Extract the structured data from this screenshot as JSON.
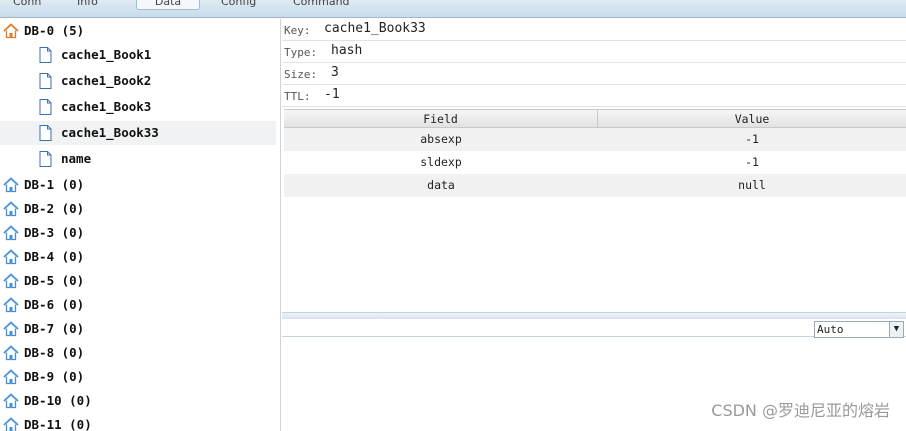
{
  "tabs": [
    "Conn",
    "Info",
    "Data",
    "Config",
    "Command"
  ],
  "tree": {
    "db0": {
      "label": "DB-0 (5)"
    },
    "keys": [
      "cache1_Book1",
      "cache1_Book2",
      "cache1_Book3",
      "cache1_Book33",
      "name"
    ],
    "dbs": [
      "DB-1 (0)",
      "DB-2 (0)",
      "DB-3 (0)",
      "DB-4 (0)",
      "DB-5 (0)",
      "DB-6 (0)",
      "DB-7 (0)",
      "DB-8 (0)",
      "DB-9 (0)",
      "DB-10 (0)",
      "DB-11 (0)"
    ]
  },
  "detail": {
    "key_label": "Key:",
    "key_value": "cache1_Book33",
    "type_label": "Type:",
    "type_value": "hash",
    "size_label": "Size:",
    "size_value": "3",
    "ttl_label": "TTL:",
    "ttl_value": "-1"
  },
  "grid": {
    "headers": {
      "field": "Field",
      "value": "Value"
    },
    "rows": [
      {
        "field": "absexp",
        "value": "-1"
      },
      {
        "field": "sldexp",
        "value": "-1"
      },
      {
        "field": "data",
        "value": "null"
      }
    ]
  },
  "format_select": {
    "value": "Auto"
  },
  "watermark": "CSDN @罗迪尼亚的熔岩",
  "icons": {
    "db": "house-icon",
    "key": "document-icon",
    "dropdown": "chevron-down-icon"
  },
  "colors": {
    "db_icon_roof": "#e07b2a",
    "db_icon_body": "#4a90d9",
    "selected_row": "#f0f2f4"
  }
}
